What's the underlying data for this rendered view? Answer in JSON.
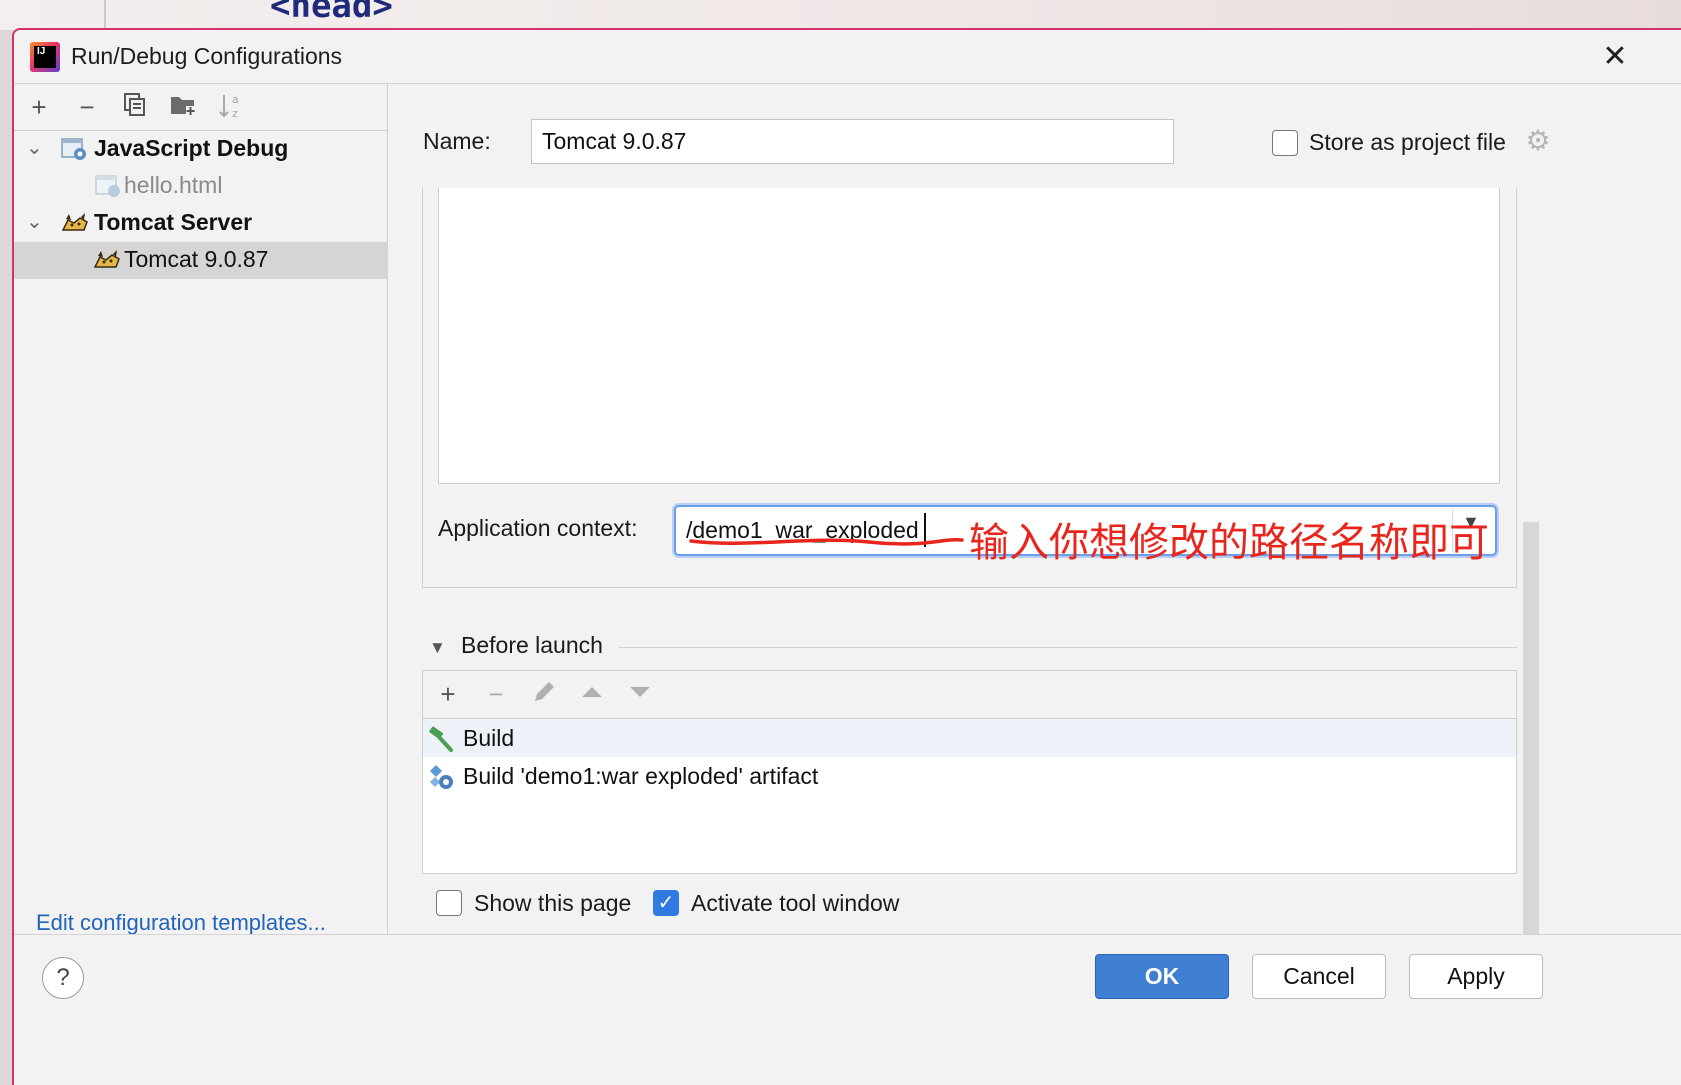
{
  "background": {
    "code_text": "<head>"
  },
  "window": {
    "title": "Run/Debug Configurations",
    "close_icon": "close-icon",
    "app_icon_text": "IJ"
  },
  "left_toolbar": {
    "add": "+",
    "remove": "−",
    "copy": "copy-icon",
    "new_folder": "folder-add-icon",
    "sort": "sort-alpha-icon"
  },
  "tree": {
    "groups": [
      {
        "label": "JavaScript Debug",
        "icon": "javascript-debug-icon",
        "children": [
          {
            "label": "hello.html",
            "icon": "html-file-icon"
          }
        ]
      },
      {
        "label": "Tomcat Server",
        "icon": "tomcat-icon",
        "children": [
          {
            "label": "Tomcat 9.0.87",
            "icon": "tomcat-icon",
            "selected": true
          }
        ]
      }
    ]
  },
  "edit_templates_link": "Edit configuration templates...",
  "form": {
    "name_label": "Name:",
    "name_value": "Tomcat 9.0.87",
    "store_label": "Store as project file",
    "store_checked": false,
    "context_label": "Application context:",
    "context_value": "/demo1_war_exploded"
  },
  "annotation": {
    "text": "输入你想修改的路径名称即可",
    "color": "#e8261d"
  },
  "before_launch": {
    "title": "Before launch",
    "items": [
      {
        "label": "Build",
        "icon": "build-hammer-icon"
      },
      {
        "label": "Build 'demo1:war exploded' artifact",
        "icon": "artifact-icon"
      }
    ]
  },
  "options": {
    "show_page_label": "Show this page",
    "show_page_checked": false,
    "activate_label": "Activate tool window",
    "activate_checked": true
  },
  "buttons": {
    "help": "?",
    "ok": "OK",
    "cancel": "Cancel",
    "apply": "Apply"
  },
  "colors": {
    "accent": "#3f7fd1",
    "window_border": "#d6306f",
    "link": "#2364b8"
  }
}
